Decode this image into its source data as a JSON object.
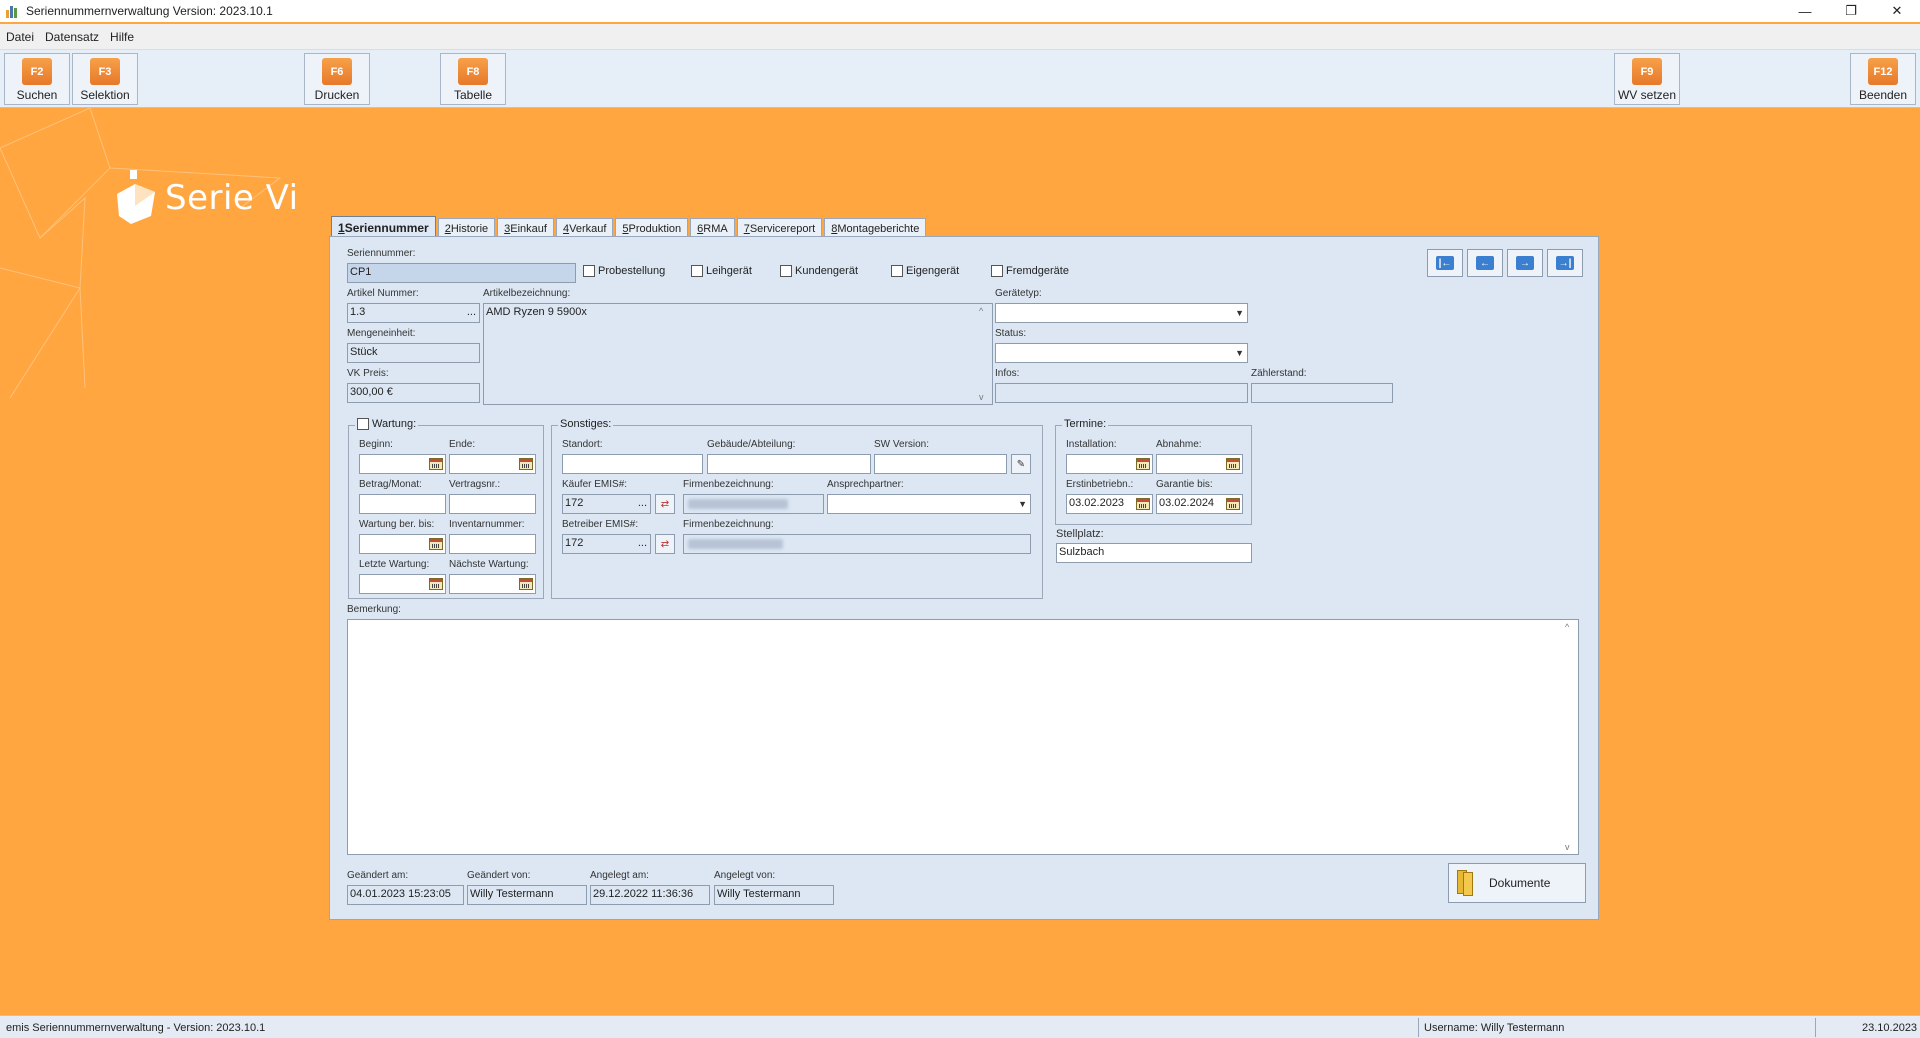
{
  "window": {
    "title": "Seriennummernverwaltung Version: 2023.10.1",
    "minimize": "—",
    "restore": "❐",
    "close": "✕"
  },
  "menu": {
    "items": [
      "Datei",
      "Datensatz",
      "Hilfe"
    ]
  },
  "toolbar": {
    "buttons": [
      {
        "key": "F2",
        "label": "Suchen"
      },
      {
        "key": "F3",
        "label": "Selektion"
      },
      {
        "key": "F6",
        "label": "Drucken"
      },
      {
        "key": "F8",
        "label": "Tabelle"
      },
      {
        "key": "F9",
        "label": "WV setzen"
      },
      {
        "key": "F12",
        "label": "Beenden"
      }
    ]
  },
  "logo": {
    "text": "Serie Vi"
  },
  "tabs": [
    {
      "num": "1",
      "label": " Seriennummer"
    },
    {
      "num": "2",
      "label": " Historie"
    },
    {
      "num": "3",
      "label": " Einkauf"
    },
    {
      "num": "4",
      "label": " Verkauf"
    },
    {
      "num": "5",
      "label": " Produktion"
    },
    {
      "num": "6",
      "label": " RMA"
    },
    {
      "num": "7",
      "label": " Servicereport"
    },
    {
      "num": "8",
      "label": " Montageberichte"
    }
  ],
  "form": {
    "seriennummer_label": "Seriennummer:",
    "seriennummer": "CP1",
    "checkboxes": [
      "Probestellung",
      "Leihgerät",
      "Kundengerät",
      "Eigengerät",
      "Fremdgeräte"
    ],
    "artikel_nummer_label": "Artikel Nummer:",
    "artikel_nummer": "1.3",
    "artikelbezeichnung_label": "Artikelbezeichnung:",
    "artikelbezeichnung": "AMD Ryzen 9 5900x",
    "mengeneinheit_label": "Mengeneinheit:",
    "mengeneinheit": "Stück",
    "vk_preis_label": "VK Preis:",
    "vk_preis": "300,00 €",
    "geraetetyp_label": "Gerätetyp:",
    "geraetetyp": "",
    "status_label": "Status:",
    "status": "",
    "infos_label": "Infos:",
    "infos": "",
    "zaehlerstand_label": "Zählerstand:",
    "zaehlerstand": "",
    "dots": "...",
    "nav": [
      "|←",
      "←",
      "→",
      "→|"
    ]
  },
  "wartung": {
    "title": "Wartung:",
    "beginn_label": "Beginn:",
    "ende_label": "Ende:",
    "betrag_label": "Betrag/Monat:",
    "vertragsnr_label": "Vertragsnr.:",
    "wartung_ber_label": "Wartung ber. bis:",
    "inventarnummer_label": "Inventarnummer:",
    "letzte_label": "Letzte Wartung:",
    "naechste_label": "Nächste Wartung:"
  },
  "sonstiges": {
    "title": "Sonstiges:",
    "standort_label": "Standort:",
    "gebaeude_label": "Gebäude/Abteilung:",
    "sw_version_label": "SW Version:",
    "kaeufer_label": "Käufer EMIS#:",
    "kaeufer": "172",
    "firmenbez_label": "Firmenbezeichnung:",
    "ansprechpartner_label": "Ansprechpartner:",
    "betreiber_label": "Betreiber EMIS#:",
    "betreiber": "172",
    "firmenbez2_label": "Firmenbezeichnung:"
  },
  "termine": {
    "title": "Termine:",
    "installation_label": "Installation:",
    "abnahme_label": "Abnahme:",
    "erstinbetrieb_label": "Erstinbetriebn.:",
    "erstinbetrieb": "03.02.2023",
    "garantie_label": "Garantie bis:",
    "garantie": "03.02.2024",
    "stellplatz_label": "Stellplatz:",
    "stellplatz": "Sulzbach"
  },
  "bemerkung": {
    "label": "Bemerkung:",
    "text": ""
  },
  "audit": {
    "geaendert_am_label": "Geändert am:",
    "geaendert_am": "04.01.2023 15:23:05",
    "geaendert_von_label": "Geändert von:",
    "geaendert_von": "Willy Testermann",
    "angelegt_am_label": "Angelegt am:",
    "angelegt_am": "29.12.2022 11:36:36",
    "angelegt_von_label": "Angelegt von:",
    "angelegt_von": "Willy Testermann"
  },
  "dokumente_label": "Dokumente",
  "statusbar": {
    "left": "emis Seriennummernverwaltung - Version: 2023.10.1",
    "user": "Username: Willy Testermann",
    "date": "23.10.2023"
  },
  "colors": {
    "accent": "#ffa640",
    "panel": "#dce7f3",
    "fkey": "#e6792a"
  }
}
